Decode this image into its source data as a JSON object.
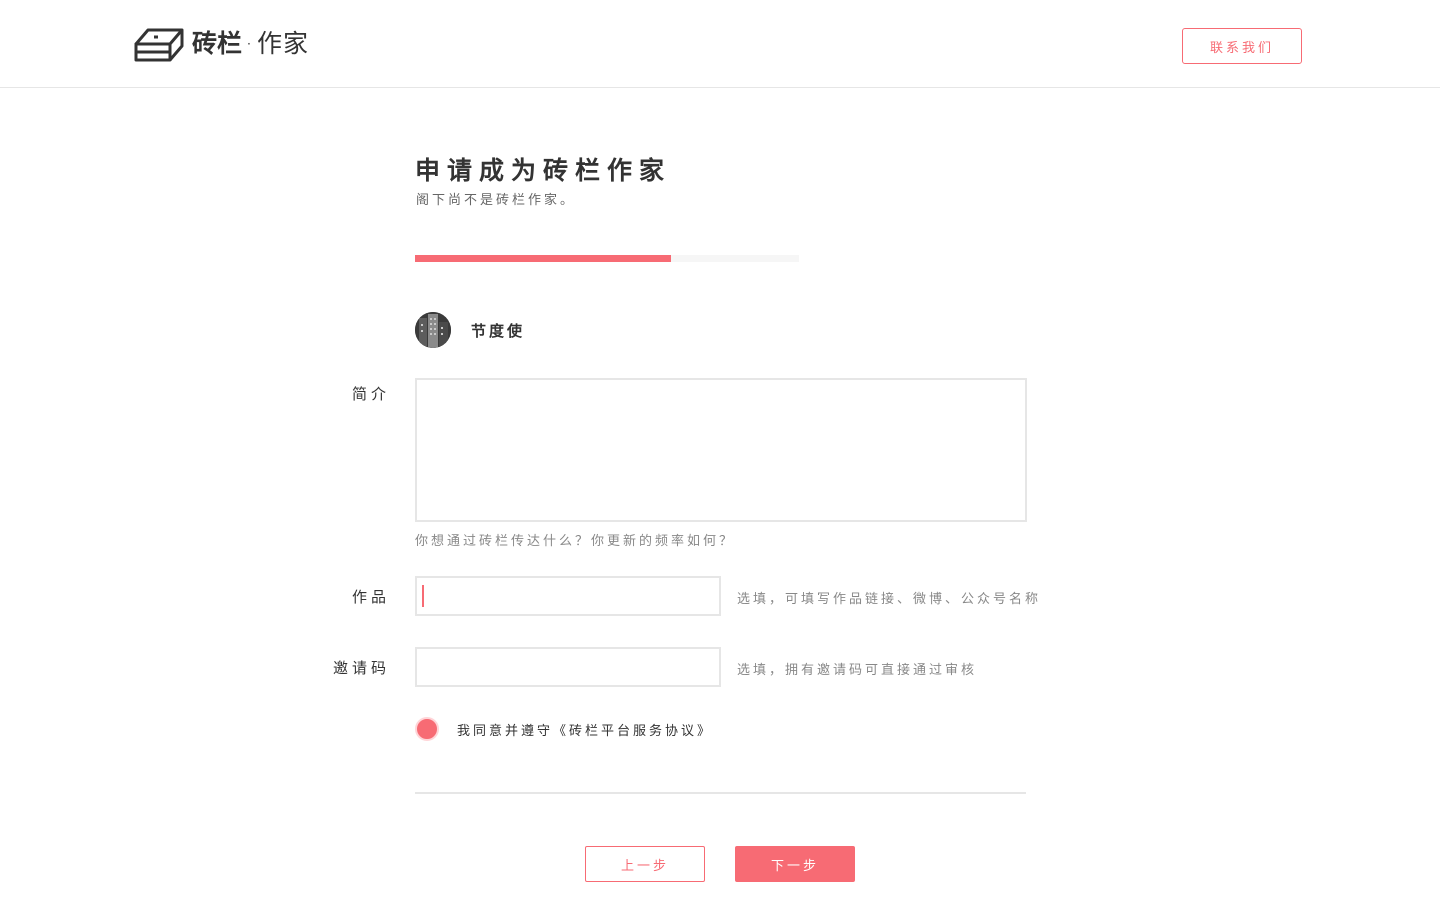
{
  "header": {
    "logo_brand": "砖栏",
    "logo_dot": "·",
    "logo_suffix": "作家",
    "contact_label": "联系我们"
  },
  "main": {
    "title": "申请成为砖栏作家",
    "subtitle": "阁下尚不是砖栏作家。",
    "progress_fraction": 0.667
  },
  "user": {
    "name": "节度使"
  },
  "form": {
    "intro_label": "简介",
    "intro_value": "",
    "intro_hint": "你想通过砖栏传达什么？你更新的频率如何？",
    "works_label": "作品",
    "works_value": "",
    "works_hint": "选填，可填写作品链接、微博、公众号名称",
    "invite_label": "邀请码",
    "invite_value": "",
    "invite_hint": "选填，拥有邀请码可直接通过审核",
    "agree_text": "我同意并遵守《砖栏平台服务协议》",
    "agree_checked": true
  },
  "actions": {
    "prev_label": "上一步",
    "next_label": "下一步"
  },
  "colors": {
    "accent": "#f76b74",
    "border": "#e6e6e6",
    "text": "#333333",
    "hint": "#888888"
  },
  "icons": {
    "logo": "brick-logo-icon",
    "agree": "checkbox-dot-icon"
  }
}
